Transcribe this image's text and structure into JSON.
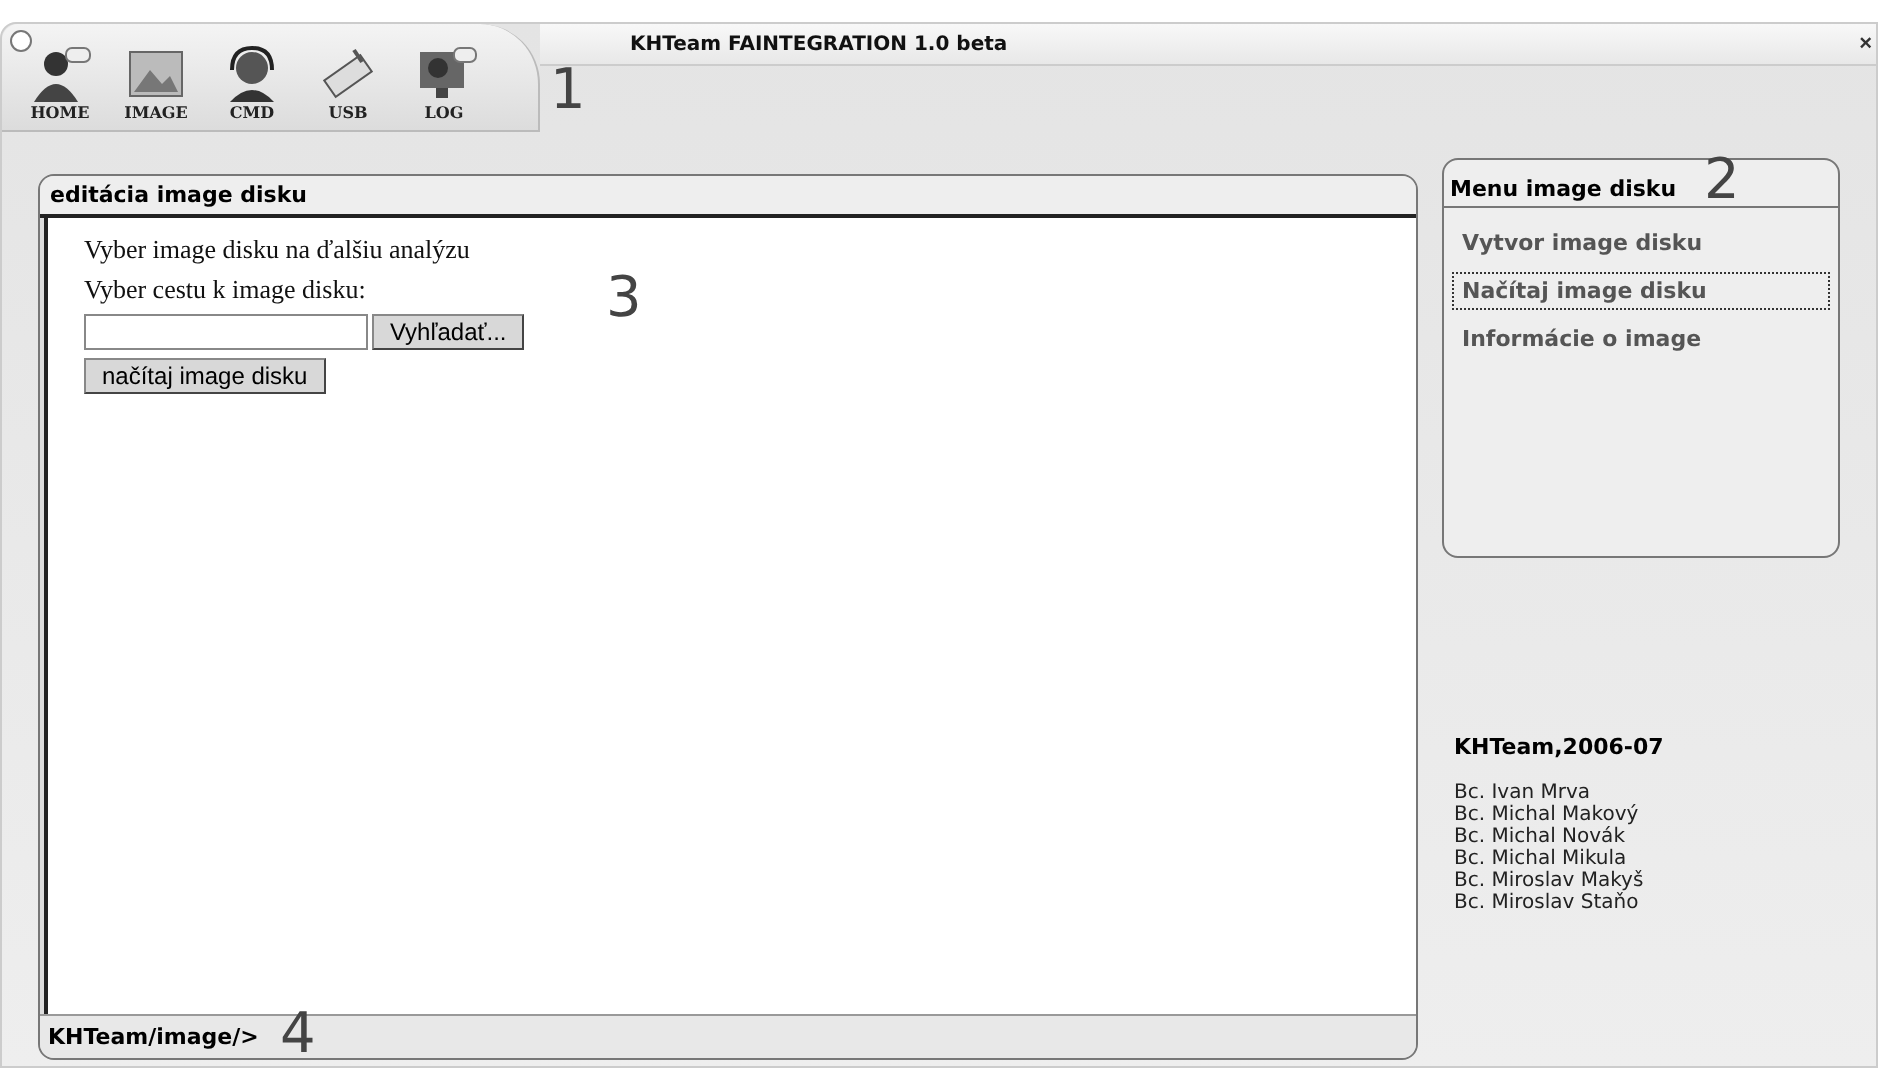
{
  "window": {
    "title": "KHTeam FAINTEGRATION 1.0 beta",
    "close": "×"
  },
  "toolbar": [
    {
      "label": "HOME",
      "kind": "person"
    },
    {
      "label": "IMAGE",
      "kind": "image"
    },
    {
      "label": "CMD",
      "kind": "headset"
    },
    {
      "label": "USB",
      "kind": "usb"
    },
    {
      "label": "LOG",
      "kind": "monitor"
    }
  ],
  "annotations": [
    "1",
    "2",
    "3",
    "4"
  ],
  "editor": {
    "title": "editácia image disku",
    "intro": "Vyber image disku na ďalšiu analýzu",
    "path_label": "Vyber cestu k image disku:",
    "browse_button": "Vyhľadať...",
    "load_button": "načítaj image disku"
  },
  "status_bar": "KHTeam/image/>",
  "menu": {
    "title": "Menu image disku",
    "items": [
      {
        "label": "Vytvor image disku",
        "selected": false
      },
      {
        "label": "Načítaj image disku",
        "selected": true
      },
      {
        "label": "Informácie o image",
        "selected": false
      }
    ]
  },
  "credits": {
    "title": "KHTeam,2006-07",
    "names": [
      "Bc. Ivan Mrva",
      "Bc. Michal Makový",
      "Bc. Michal Novák",
      "Bc. Michal Mikula",
      "Bc. Miroslav Makyš",
      "Bc. Miroslav Staňo"
    ]
  }
}
